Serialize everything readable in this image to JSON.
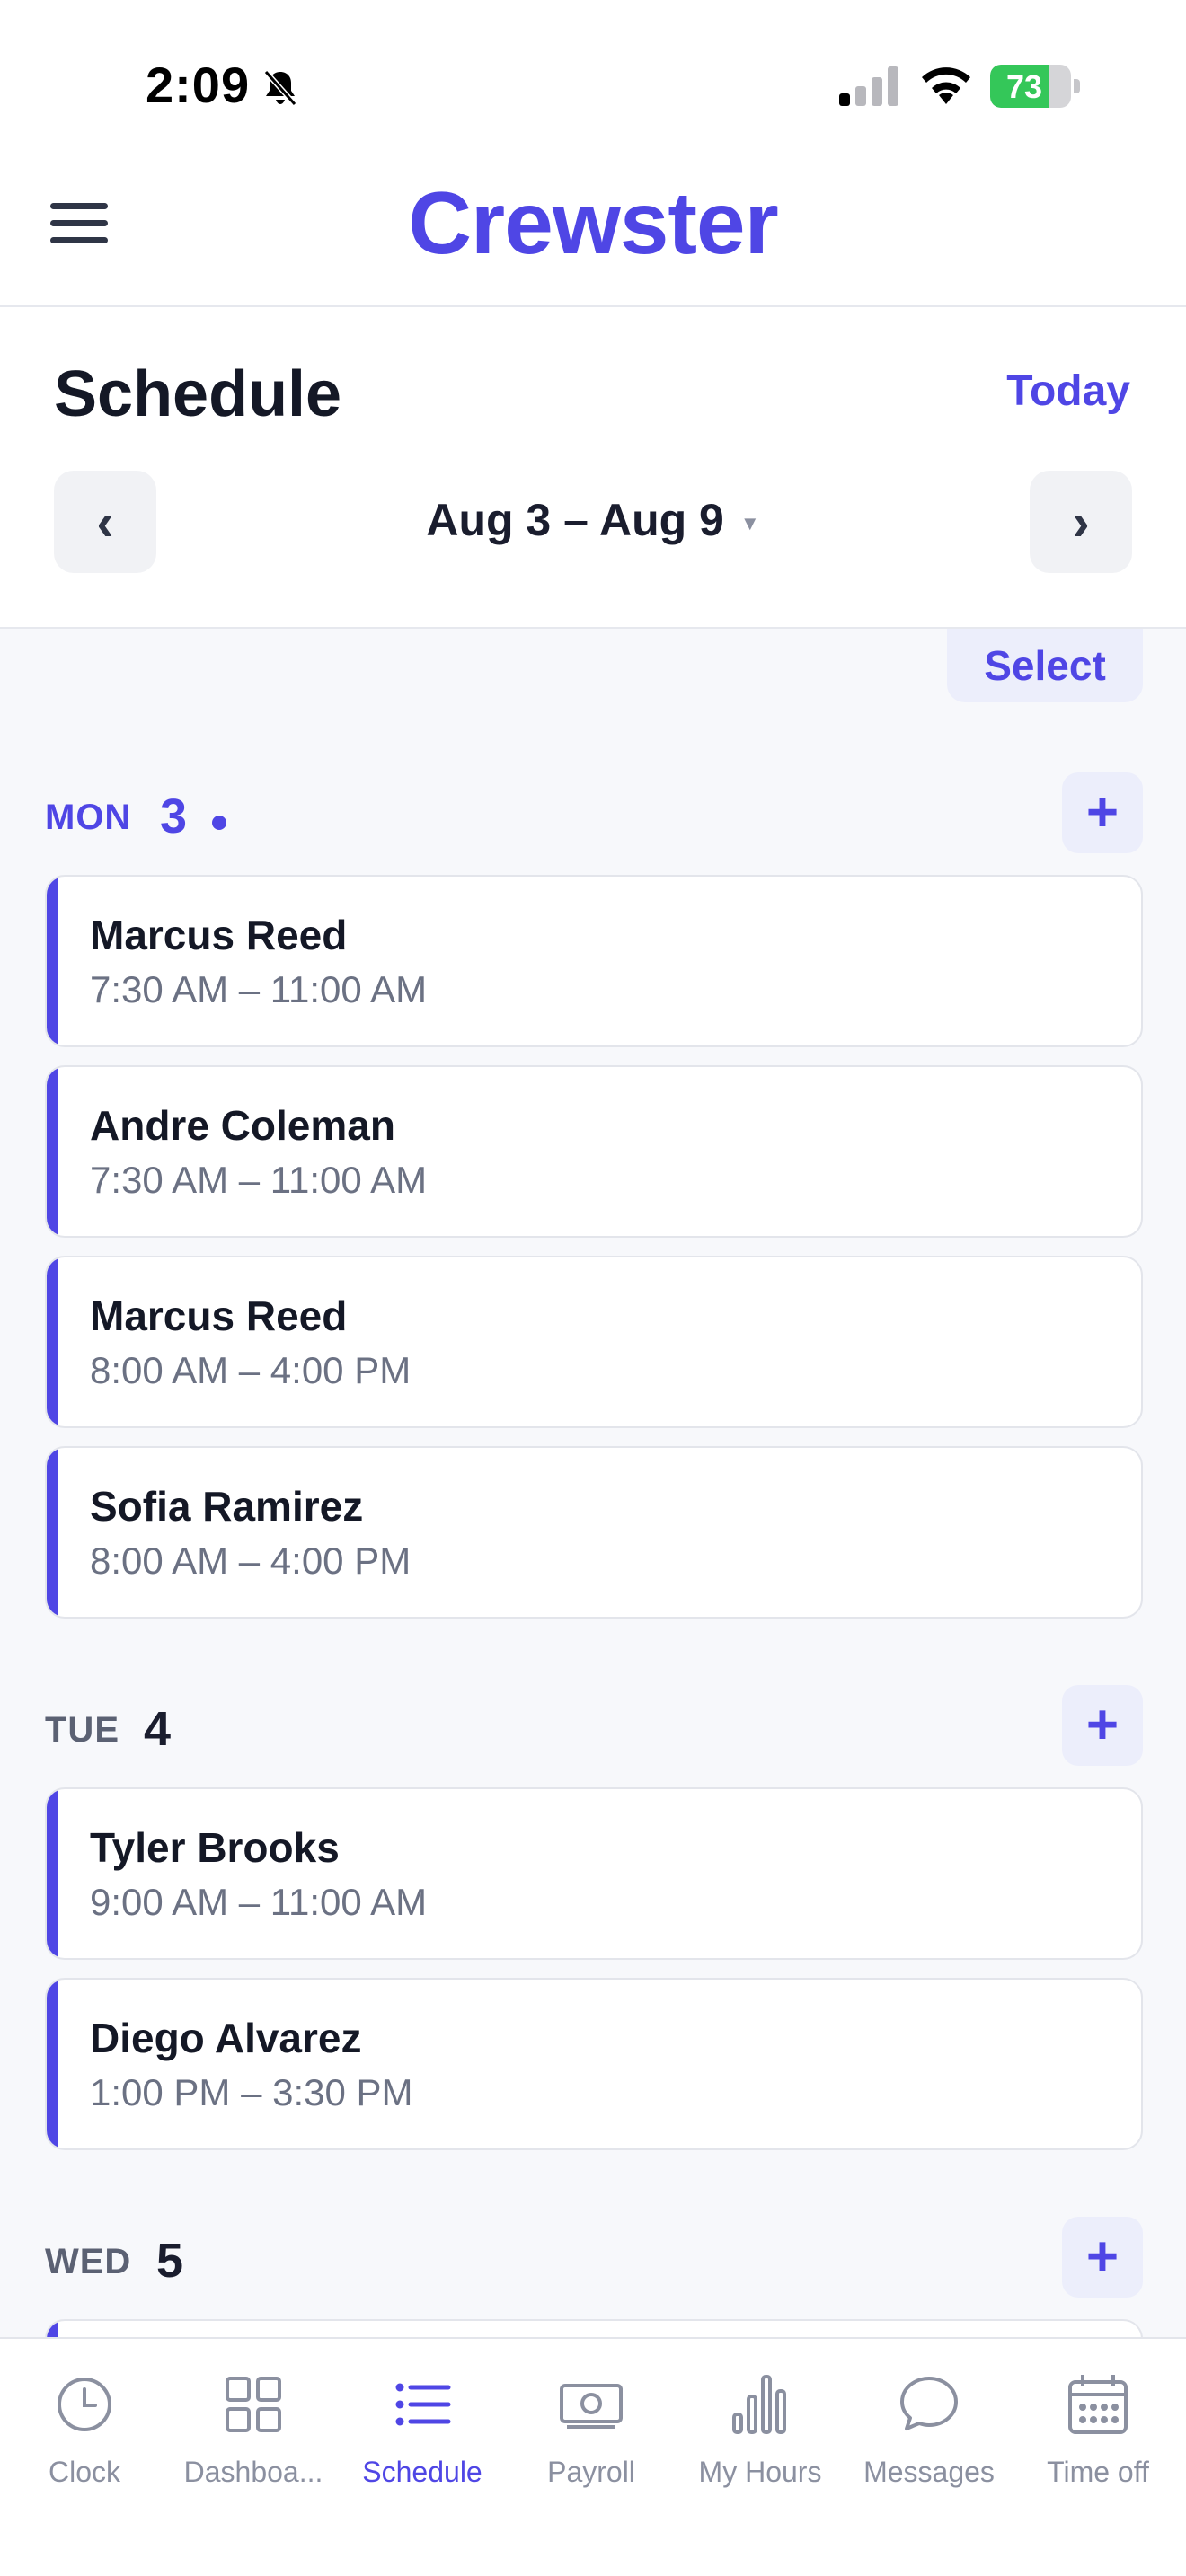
{
  "status_bar": {
    "time": "2:09",
    "battery_percent": "73",
    "battery_level": 0.73,
    "icons": [
      "bell-muted-icon",
      "cellular-signal-icon",
      "wifi-icon",
      "battery-charging-icon"
    ]
  },
  "header": {
    "brand": "Crewster",
    "menu_icon": "hamburger-menu-icon"
  },
  "schedule": {
    "title": "Schedule",
    "today_label": "Today",
    "week_range": "Aug 3 – Aug 9",
    "prev_icon": "‹",
    "next_icon": "›",
    "select_label": "Select"
  },
  "days": [
    {
      "weekday": "MON",
      "day": "3",
      "is_today": true,
      "shifts": [
        {
          "name": "Marcus Reed",
          "time": "7:30 AM – 11:00 AM"
        },
        {
          "name": "Andre Coleman",
          "time": "7:30 AM – 11:00 AM"
        },
        {
          "name": "Marcus Reed",
          "time": "8:00 AM – 4:00 PM"
        },
        {
          "name": "Sofia Ramirez",
          "time": "8:00 AM – 4:00 PM"
        }
      ]
    },
    {
      "weekday": "TUE",
      "day": "4",
      "is_today": false,
      "shifts": [
        {
          "name": "Tyler Brooks",
          "time": "9:00 AM – 11:00 AM"
        },
        {
          "name": "Diego Alvarez",
          "time": "1:00 PM – 3:30 PM"
        }
      ]
    },
    {
      "weekday": "WED",
      "day": "5",
      "is_today": false,
      "shifts": []
    }
  ],
  "add_label": "+",
  "tabs": [
    {
      "label": "Clock",
      "icon": "clock-icon",
      "active": false
    },
    {
      "label": "Dashboa...",
      "icon": "dashboard-grid-icon",
      "active": false
    },
    {
      "label": "Schedule",
      "icon": "list-icon",
      "active": true
    },
    {
      "label": "Payroll",
      "icon": "money-bill-icon",
      "active": false
    },
    {
      "label": "My Hours",
      "icon": "bar-chart-icon",
      "active": false
    },
    {
      "label": "Messages",
      "icon": "chat-bubble-icon",
      "active": false
    },
    {
      "label": "Time off",
      "icon": "calendar-icon",
      "active": false
    }
  ],
  "colors": {
    "accent": "#4f46e5",
    "accent_soft": "#eceefb",
    "text": "#141826",
    "muted": "#6b7183",
    "battery_green": "#34c759"
  }
}
